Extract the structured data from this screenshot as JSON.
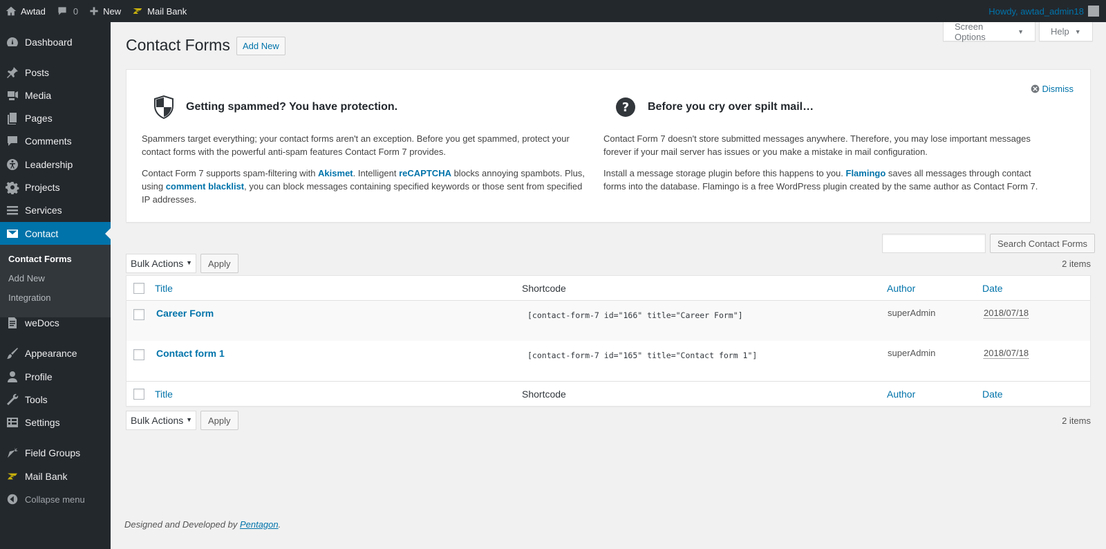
{
  "adminbar": {
    "site_name": "Awtad",
    "comments_count": "0",
    "new_label": "New",
    "mailbank_label": "Mail Bank",
    "howdy": "Howdy, awtad_admin18"
  },
  "sidebar": {
    "items": [
      {
        "label": "Dashboard",
        "icon": "dashboard-icon"
      },
      {
        "label": "Posts",
        "icon": "pin-icon"
      },
      {
        "label": "Media",
        "icon": "media-icon"
      },
      {
        "label": "Pages",
        "icon": "pages-icon"
      },
      {
        "label": "Comments",
        "icon": "comment-icon"
      },
      {
        "label": "Leadership",
        "icon": "accessibility-icon"
      },
      {
        "label": "Projects",
        "icon": "gear-icon"
      },
      {
        "label": "Services",
        "icon": "list-icon"
      },
      {
        "label": "Contact",
        "icon": "email-icon"
      },
      {
        "label": "weDocs",
        "icon": "document-icon"
      },
      {
        "label": "Appearance",
        "icon": "brush-icon"
      },
      {
        "label": "Profile",
        "icon": "user-icon"
      },
      {
        "label": "Tools",
        "icon": "wrench-icon"
      },
      {
        "label": "Settings",
        "icon": "settings-icon"
      },
      {
        "label": "Field Groups",
        "icon": "carrot-icon"
      },
      {
        "label": "Mail Bank",
        "icon": "mailbank-icon"
      },
      {
        "label": "Collapse menu",
        "icon": "collapse-icon"
      }
    ],
    "submenu": [
      "Contact Forms",
      "Add New",
      "Integration"
    ]
  },
  "screen_options": "Screen Options",
  "help": "Help",
  "page": {
    "title": "Contact Forms",
    "add_new": "Add New"
  },
  "welcome": {
    "dismiss": "Dismiss",
    "left": {
      "heading": "Getting spammed? You have protection.",
      "p1": "Spammers target everything; your contact forms aren't an exception. Before you get spammed, protect your contact forms with the powerful anti-spam features Contact Form 7 provides.",
      "p2_a": "Contact Form 7 supports spam-filtering with ",
      "akismet": "Akismet",
      "p2_b": ". Intelligent ",
      "recaptcha": "reCAPTCHA",
      "p2_c": " blocks annoying spambots. Plus, using ",
      "blacklist": "comment blacklist",
      "p2_d": ", you can block messages containing specified keywords or those sent from specified IP addresses."
    },
    "right": {
      "heading": "Before you cry over spilt mail…",
      "p1": "Contact Form 7 doesn't store submitted messages anywhere. Therefore, you may lose important messages forever if your mail server has issues or you make a mistake in mail configuration.",
      "p2_a": "Install a message storage plugin before this happens to you. ",
      "flamingo": "Flamingo",
      "p2_b": " saves all messages through contact forms into the database. Flamingo is a free WordPress plugin created by the same author as Contact Form 7."
    }
  },
  "search_button": "Search Contact Forms",
  "tablenav": {
    "bulk_actions": "Bulk Actions",
    "apply": "Apply",
    "items_count": "2 items"
  },
  "table": {
    "headers": {
      "title": "Title",
      "shortcode": "Shortcode",
      "author": "Author",
      "date": "Date"
    },
    "rows": [
      {
        "title": "Career Form",
        "shortcode": "[contact-form-7 id=\"166\" title=\"Career Form\"]",
        "author": "superAdmin",
        "date": "2018/07/18"
      },
      {
        "title": "Contact form 1",
        "shortcode": "[contact-form-7 id=\"165\" title=\"Contact form 1\"]",
        "author": "superAdmin",
        "date": "2018/07/18"
      }
    ]
  },
  "footer": {
    "text": "Designed and Developed by ",
    "link": "Pentagon",
    "end": "."
  }
}
